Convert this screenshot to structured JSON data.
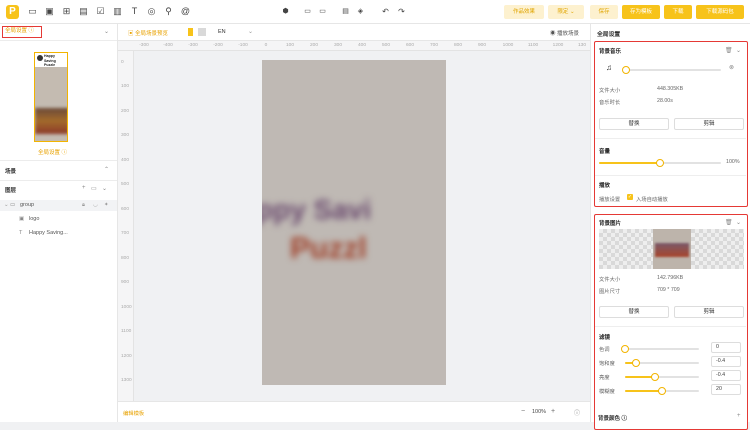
{
  "toolbar": {
    "logo": "P",
    "tools": [
      "▭",
      "▣",
      "⊞",
      "▤",
      "☑",
      "▥",
      "T",
      "◎",
      "⚲",
      "@"
    ],
    "mid_icons": [
      "⬢",
      "▭",
      "▭",
      "▤",
      "◈",
      "↶",
      "↷"
    ],
    "buttons": {
      "preview": "作品效果",
      "template": "限定 ⌄",
      "save": "保存",
      "save_as": "存为模板",
      "download": "下载",
      "download_open": "下载源码包"
    }
  },
  "left": {
    "scene_tab": "全局设置 ⓘ",
    "thumb_caption": "全局设置 ⓘ",
    "thumb_text": [
      "Happy Saving",
      "Puzzle"
    ],
    "scenes_title": "场景",
    "layers_title": "图层",
    "tree": {
      "group": "group",
      "logo": "logo",
      "text": "Happy Saving..."
    }
  },
  "canvas_bar": {
    "tab_label": "全局场景预览",
    "lang": "EN",
    "play": "播放场景"
  },
  "ruler": {
    "h": [
      "-300",
      "-400",
      "-300",
      "-200",
      "-100",
      "0",
      "100",
      "200",
      "300",
      "400",
      "500",
      "600",
      "700",
      "800",
      "900",
      "1000",
      "1100",
      "1200",
      "130"
    ],
    "v": [
      "0",
      "100",
      "200",
      "300",
      "400",
      "500",
      "600",
      "700",
      "800",
      "900",
      "1000",
      "1100",
      "1200",
      "1300"
    ]
  },
  "canvas_art": [
    "ppy Savi",
    "Puzzl"
  ],
  "bottom": {
    "left_text": "编辑模板",
    "zoom": "100%",
    "zoom_minus": "−",
    "zoom_plus": "+"
  },
  "right": {
    "header": "全局设置",
    "music": {
      "title": "背景音乐",
      "size_label": "文件大小",
      "size_value": "448.305KB",
      "dur_label": "音乐时长",
      "dur_value": "28.00s",
      "replace": "替换",
      "crop": "剪辑",
      "volume_title": "音量",
      "volume_value": "100%",
      "volume_fraction": 0.5,
      "play_title": "播放",
      "play_label": "播放设置",
      "autoplay": "入场自动播放"
    },
    "image": {
      "title": "背景图片",
      "size_label": "文件大小",
      "size_value": "142.796KB",
      "dim_label": "图片尺寸",
      "dim_value": "709 * 709",
      "replace": "替换",
      "crop": "剪辑",
      "filter_title": "滤镜",
      "filters": [
        {
          "label": "色调",
          "value": "0",
          "fraction": 0.0
        },
        {
          "label": "饱和度",
          "value": "-0.4",
          "fraction": 0.15
        },
        {
          "label": "亮度",
          "value": "-0.4",
          "fraction": 0.4
        },
        {
          "label": "模糊度",
          "value": "20",
          "fraction": 0.5
        }
      ]
    },
    "bg_color": "背景颜色 ⓘ"
  },
  "colors": {
    "accent": "#f7c31a",
    "highlight": "#e53935"
  }
}
